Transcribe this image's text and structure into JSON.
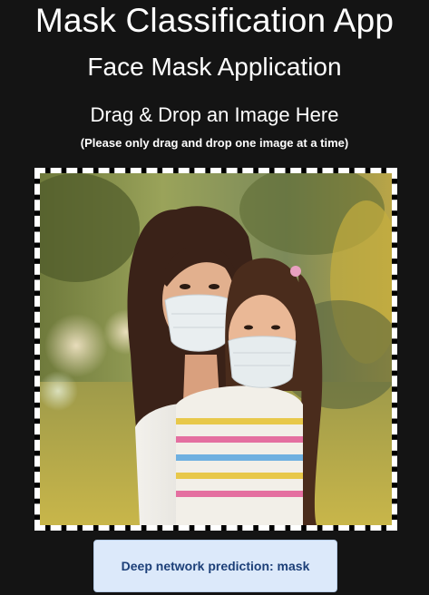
{
  "header": {
    "app_title": "Mask Classification App",
    "subtitle": "Face Mask Application"
  },
  "upload": {
    "heading": "Drag & Drop an Image Here",
    "note": "(Please only drag and drop one image at a time)",
    "image_description": "photo-of-woman-and-girl-wearing-face-masks"
  },
  "result": {
    "prediction_text": "Deep network prediction: mask"
  },
  "colors": {
    "background": "#141414",
    "text": "#ffffff",
    "result_bg": "#dce9fa",
    "result_text": "#1c3f78"
  }
}
